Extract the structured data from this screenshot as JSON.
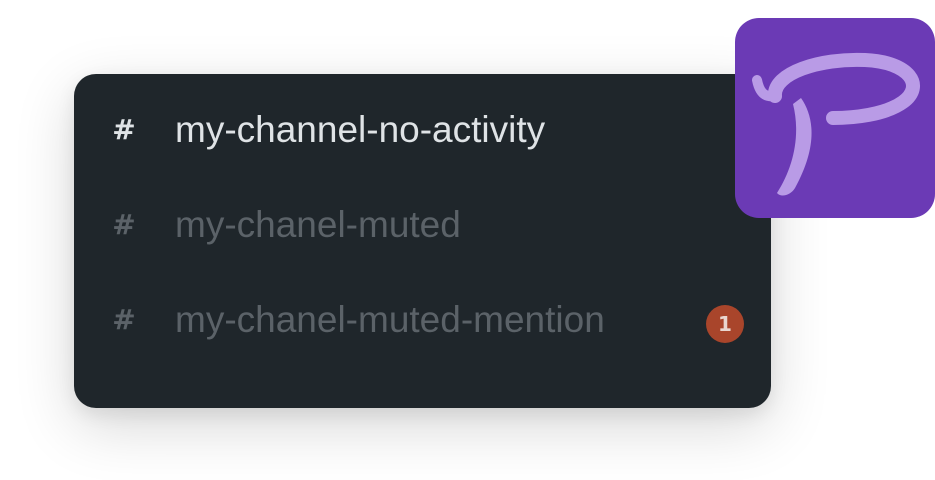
{
  "channels": [
    {
      "label": "my-channel-no-activity",
      "prefix": "#",
      "state": "active"
    },
    {
      "label": "my-chanel-muted",
      "prefix": "#",
      "state": "muted"
    },
    {
      "label": "my-chanel-muted-mention",
      "prefix": "#",
      "state": "muted",
      "mention_count": "1"
    }
  ],
  "logo": {
    "icon": "pidgin-p-logo-icon",
    "background_color": "#6b3ab5",
    "mark_color": "#b99be6"
  },
  "colors": {
    "panel_bg": "#1f262b",
    "active_text": "#dfe3e6",
    "muted_text": "#5b6268",
    "badge_bg": "#a9452b"
  }
}
